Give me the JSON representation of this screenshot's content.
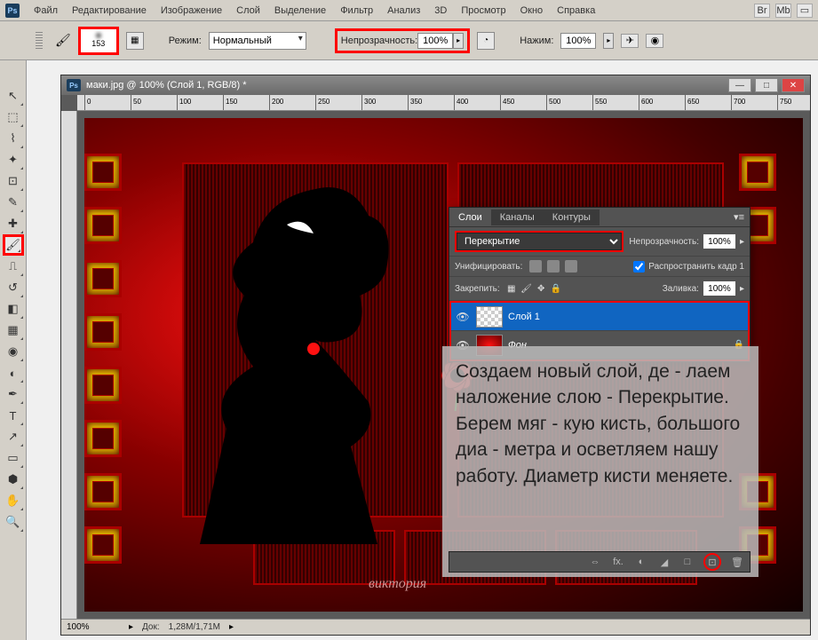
{
  "menu": {
    "items": [
      "Файл",
      "Редактирование",
      "Изображение",
      "Слой",
      "Выделение",
      "Фильтр",
      "Анализ",
      "3D",
      "Просмотр",
      "Окно",
      "Справка"
    ],
    "right": [
      "Br",
      "Mb"
    ]
  },
  "options": {
    "brush_size": "153",
    "mode_label": "Режим:",
    "mode_value": "Нормальный",
    "opacity_label": "Непрозрачность:",
    "opacity_value": "100%",
    "flow_label": "Нажим:",
    "flow_value": "100%"
  },
  "document": {
    "title": "маки.jpg @ 100% (Слой 1, RGB/8) *",
    "zoom": "100%",
    "docsize_label": "Док:",
    "docsize": "1,28M/1,71M",
    "ruler_ticks": [
      "0",
      "50",
      "100",
      "150",
      "200",
      "250",
      "300",
      "350",
      "400",
      "450",
      "500",
      "550",
      "600",
      "650",
      "700",
      "750"
    ],
    "signature": "виктория"
  },
  "layers_panel": {
    "tabs": [
      "Слои",
      "Каналы",
      "Контуры"
    ],
    "blend_mode": "Перекрытие",
    "opacity_label": "Непрозрачность:",
    "opacity_value": "100%",
    "unify_label": "Унифицировать:",
    "propagate_label": "Распространить кадр 1",
    "lock_label": "Закрепить:",
    "fill_label": "Заливка:",
    "fill_value": "100%",
    "layers": [
      {
        "name": "Слой 1",
        "visible": true,
        "selected": true,
        "locked": false
      },
      {
        "name": "Фон",
        "visible": true,
        "selected": false,
        "locked": true
      }
    ],
    "footer_icons": [
      "⇔",
      "fx.",
      "◐",
      "◢",
      "□",
      "⊡",
      "🗑"
    ]
  },
  "tutorial_text": "Создаем новый слой, де - лаем наложение слою - Перекрытие. Берем мяг - кую кисть, большого диа - метра и осветляем нашу работу. Диаметр кисти меняете.",
  "tools": [
    {
      "name": "move",
      "glyph": "↖"
    },
    {
      "name": "marquee",
      "glyph": "⬚"
    },
    {
      "name": "lasso",
      "glyph": "⌇"
    },
    {
      "name": "wand",
      "glyph": "✦"
    },
    {
      "name": "crop",
      "glyph": "⊡"
    },
    {
      "name": "eyedropper",
      "glyph": "✎"
    },
    {
      "name": "healing",
      "glyph": "✚"
    },
    {
      "name": "brush",
      "glyph": "🖌",
      "active": true
    },
    {
      "name": "stamp",
      "glyph": "⎍"
    },
    {
      "name": "history",
      "glyph": "↺"
    },
    {
      "name": "eraser",
      "glyph": "◧"
    },
    {
      "name": "gradient",
      "glyph": "▦"
    },
    {
      "name": "blur",
      "glyph": "◉"
    },
    {
      "name": "dodge",
      "glyph": "◐"
    },
    {
      "name": "pen",
      "glyph": "✒"
    },
    {
      "name": "type",
      "glyph": "T"
    },
    {
      "name": "path",
      "glyph": "↗"
    },
    {
      "name": "shape",
      "glyph": "▭"
    },
    {
      "name": "3d",
      "glyph": "⬢"
    },
    {
      "name": "hand",
      "glyph": "✋"
    },
    {
      "name": "zoom",
      "glyph": "🔍"
    }
  ]
}
